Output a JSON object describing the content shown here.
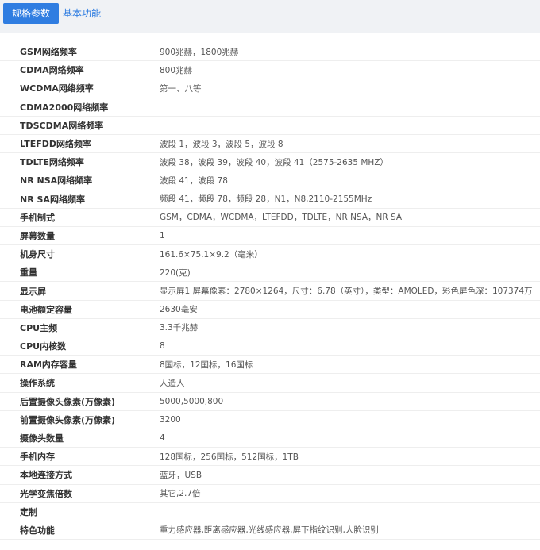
{
  "tabs": [
    {
      "label": "规格参数",
      "active": true
    },
    {
      "label": "基本功能",
      "active": false
    }
  ],
  "colors": {
    "accent": "#2f7de1",
    "top_bar_bg": "#f0f2f5",
    "row_border": "#eeeeee"
  },
  "specs": [
    {
      "label": "GSM网络频率",
      "value": "900兆赫，1800兆赫"
    },
    {
      "label": "CDMA网络频率",
      "value": "800兆赫"
    },
    {
      "label": "WCDMA网络频率",
      "value": "第一、八等"
    },
    {
      "label": "CDMA2000网络频率",
      "value": ""
    },
    {
      "label": "TDSCDMA网络频率",
      "value": ""
    },
    {
      "label": "LTEFDD网络频率",
      "value": "波段 1，波段 3，波段 5，波段 8"
    },
    {
      "label": "TDLTE网络频率",
      "value": "波段 38，波段 39，波段 40，波段 41（2575-2635 MHZ）"
    },
    {
      "label": "NR NSA网络频率",
      "value": "波段 41，波段 78"
    },
    {
      "label": "NR SA网络频率",
      "value": "频段 41，频段 78，频段 28，N1，N8,2110-2155MHz"
    },
    {
      "label": "手机制式",
      "value": "GSM，CDMA，WCDMA，LTEFDD，TDLTE，NR NSA，NR SA"
    },
    {
      "label": "屏幕数量",
      "value": "1"
    },
    {
      "label": "机身尺寸",
      "value": "161.6×75.1×9.2（毫米）"
    },
    {
      "label": "重量",
      "value": "220(克)"
    },
    {
      "label": "显示屏",
      "value": "显示屏1 屏幕像素：2780×1264，尺寸：6.78（英寸），类型：AMOLED，彩色屏色深：107374万"
    },
    {
      "label": "电池额定容量",
      "value": "2630毫安"
    },
    {
      "label": "CPU主频",
      "value": "3.3千兆赫"
    },
    {
      "label": "CPU内核数",
      "value": "8"
    },
    {
      "label": "RAM内存容量",
      "value": "8国标，12国标，16国标"
    },
    {
      "label": "操作系统",
      "value": "人造人"
    },
    {
      "label": "后置摄像头像素(万像素)",
      "value": "5000,5000,800"
    },
    {
      "label": "前置摄像头像素(万像素)",
      "value": "3200"
    },
    {
      "label": "摄像头数量",
      "value": "4"
    },
    {
      "label": "手机内存",
      "value": "128国标，256国标，512国标，1TB"
    },
    {
      "label": "本地连接方式",
      "value": "蓝牙，USB"
    },
    {
      "label": "光学变焦倍数",
      "value": "其它,2.7倍"
    },
    {
      "label": "定制",
      "value": ""
    },
    {
      "label": "特色功能",
      "value": "重力感应器,距离感应器,光线感应器,屏下指纹识别,人脸识别"
    }
  ]
}
